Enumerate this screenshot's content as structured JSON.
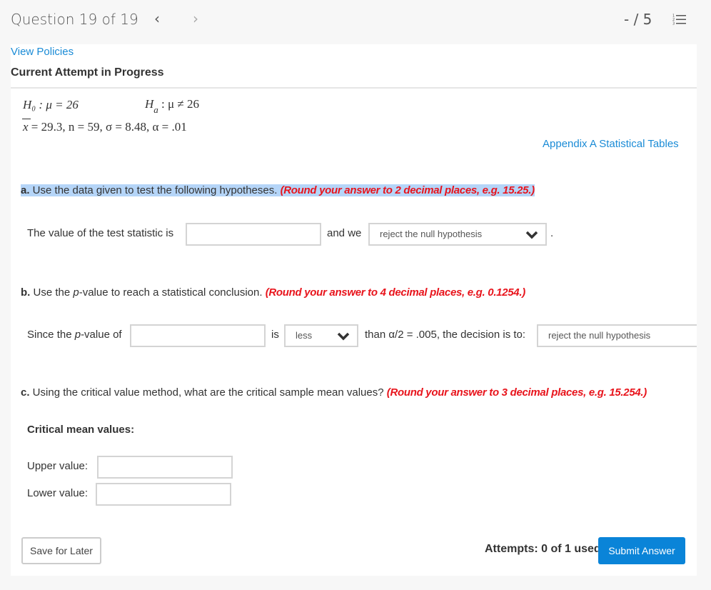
{
  "header": {
    "question_label": "Question 19 of 19",
    "prev_icon": "chevron-left-icon",
    "next_icon": "chevron-right-icon",
    "score": "- / 5",
    "list_icon": "numbered-list-icon"
  },
  "panel": {
    "view_policies": "View Policies",
    "attempt_title": "Current Attempt in Progress",
    "appendix_link": "Appendix A Statistical Tables"
  },
  "problem": {
    "h0": "H₀ : μ = 26",
    "ha_H": "H",
    "ha_sub": "a",
    "ha_rest": " : μ ≠ 26",
    "xbar": "x",
    "givens_rest": " = 29.3,  n = 59,  σ = 8.48,  α = .01"
  },
  "part_a": {
    "letter": "a.",
    "prompt": " Use the data given to test the following hypotheses. ",
    "note": "(Round your answer to 2 decimal places, e.g. 15.25.)",
    "label_before": "The value of the test statistic is",
    "statistic_value": "",
    "label_mid": "and we",
    "decision_selected": "reject the null hypothesis",
    "label_end": "."
  },
  "part_b": {
    "letter": "b.",
    "prompt_1": " Use the ",
    "prompt_p": "p",
    "prompt_2": "-value to reach a statistical conclusion. ",
    "note": "(Round your answer to 4 decimal places, e.g. 0.1254.)",
    "label_since_1": "Since the ",
    "label_since_p": "p",
    "label_since_2": "-value of",
    "pvalue": "",
    "label_is": "is",
    "comparison_selected": "less",
    "label_than": "than α/2 = .005, the decision is to:",
    "decision_selected": "reject the null hypothesis"
  },
  "part_c": {
    "letter": "c.",
    "prompt": " Using the critical value method, what are the critical sample mean values? ",
    "note": "(Round your answer to 3 decimal places, e.g. 15.254.)",
    "heading": "Critical mean values:",
    "upper_label": "Upper value:",
    "upper_value": "",
    "lower_label": "Lower value:",
    "lower_value": ""
  },
  "footer": {
    "save_label": "Save for Later",
    "attempts": "Attempts: 0 of 1 used",
    "submit_label": "Submit Answer"
  },
  "colors": {
    "link": "#1a8bd6",
    "note_red": "#e8141c",
    "submit_blue": "#0a84d8",
    "highlight": "#b5d5f8"
  }
}
